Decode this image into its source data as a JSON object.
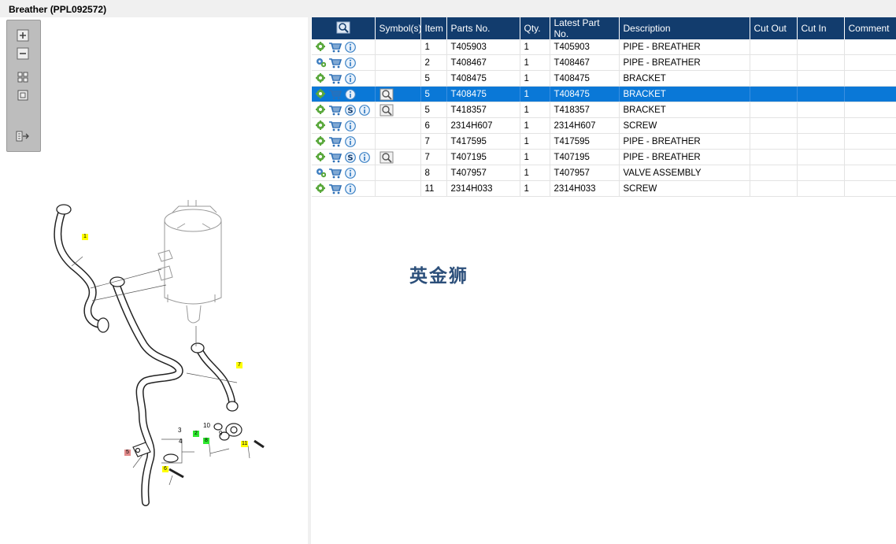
{
  "window": {
    "title": "Breather (PPL092572)"
  },
  "toolbar": {
    "buttons": [
      {
        "name": "zoom-in",
        "icon": "zoom-in-icon"
      },
      {
        "name": "zoom-out",
        "icon": "zoom-out-icon"
      },
      {
        "name": "fit-all",
        "icon": "fit-all-icon"
      },
      {
        "name": "actual-size",
        "icon": "actual-size-icon"
      },
      {
        "name": "export",
        "icon": "export-icon"
      }
    ]
  },
  "diagram": {
    "callouts": [
      {
        "label": "1",
        "style": "y"
      },
      {
        "label": "2",
        "style": "g"
      },
      {
        "label": "3",
        "style": "plain"
      },
      {
        "label": "4",
        "style": "plain"
      },
      {
        "label": "5",
        "style": "r"
      },
      {
        "label": "6",
        "style": "y"
      },
      {
        "label": "7",
        "style": "y"
      },
      {
        "label": "8",
        "style": "g"
      },
      {
        "label": "9",
        "style": "plain"
      },
      {
        "label": "10",
        "style": "plain"
      },
      {
        "label": "11",
        "style": "y"
      }
    ]
  },
  "table": {
    "columns": [
      "",
      "Symbol(s)",
      "Item",
      "Parts No.",
      "Qty.",
      "Latest Part No.",
      "Description",
      "Cut Out",
      "Cut In",
      "Comment"
    ],
    "rows": [
      {
        "gear": "gear",
        "s_icon": false,
        "symbol": false,
        "item": "1",
        "part": "T405903",
        "qty": "1",
        "latest": "T405903",
        "desc": "PIPE - BREATHER",
        "cut_out": "",
        "cut_in": "",
        "comment": "",
        "selected": false
      },
      {
        "gear": "gears",
        "s_icon": false,
        "symbol": false,
        "item": "2",
        "part": "T408467",
        "qty": "1",
        "latest": "T408467",
        "desc": "PIPE - BREATHER",
        "cut_out": "",
        "cut_in": "",
        "comment": "",
        "selected": false
      },
      {
        "gear": "gear",
        "s_icon": false,
        "symbol": false,
        "item": "5",
        "part": "T408475",
        "qty": "1",
        "latest": "T408475",
        "desc": "BRACKET",
        "cut_out": "",
        "cut_in": "",
        "comment": "",
        "selected": false
      },
      {
        "gear": "gear",
        "s_icon": false,
        "symbol": true,
        "item": "5",
        "part": "T408475",
        "qty": "1",
        "latest": "T408475",
        "desc": "BRACKET",
        "cut_out": "",
        "cut_in": "",
        "comment": "",
        "selected": true
      },
      {
        "gear": "gear",
        "s_icon": true,
        "symbol": true,
        "item": "5",
        "part": "T418357",
        "qty": "1",
        "latest": "T418357",
        "desc": "BRACKET",
        "cut_out": "",
        "cut_in": "",
        "comment": "",
        "selected": false
      },
      {
        "gear": "gear",
        "s_icon": false,
        "symbol": false,
        "item": "6",
        "part": "2314H607",
        "qty": "1",
        "latest": "2314H607",
        "desc": "SCREW",
        "cut_out": "",
        "cut_in": "",
        "comment": "",
        "selected": false
      },
      {
        "gear": "gear",
        "s_icon": false,
        "symbol": false,
        "item": "7",
        "part": "T417595",
        "qty": "1",
        "latest": "T417595",
        "desc": "PIPE - BREATHER",
        "cut_out": "",
        "cut_in": "",
        "comment": "",
        "selected": false
      },
      {
        "gear": "gear",
        "s_icon": true,
        "symbol": true,
        "item": "7",
        "part": "T407195",
        "qty": "1",
        "latest": "T407195",
        "desc": "PIPE - BREATHER",
        "cut_out": "",
        "cut_in": "",
        "comment": "",
        "selected": false
      },
      {
        "gear": "gears",
        "s_icon": false,
        "symbol": false,
        "item": "8",
        "part": "T407957",
        "qty": "1",
        "latest": "T407957",
        "desc": "VALVE ASSEMBLY",
        "cut_out": "",
        "cut_in": "",
        "comment": "",
        "selected": false
      },
      {
        "gear": "gear",
        "s_icon": false,
        "symbol": false,
        "item": "11",
        "part": "2314H033",
        "qty": "1",
        "latest": "2314H033",
        "desc": "SCREW",
        "cut_out": "",
        "cut_in": "",
        "comment": "",
        "selected": false
      }
    ]
  },
  "watermark": {
    "text": "英金狮"
  },
  "colors": {
    "header": "#123c6d",
    "selected_row": "#0a78d7",
    "gear": "#5aa83c",
    "cart": "#2d6fb5",
    "info": "#3d83c6"
  }
}
